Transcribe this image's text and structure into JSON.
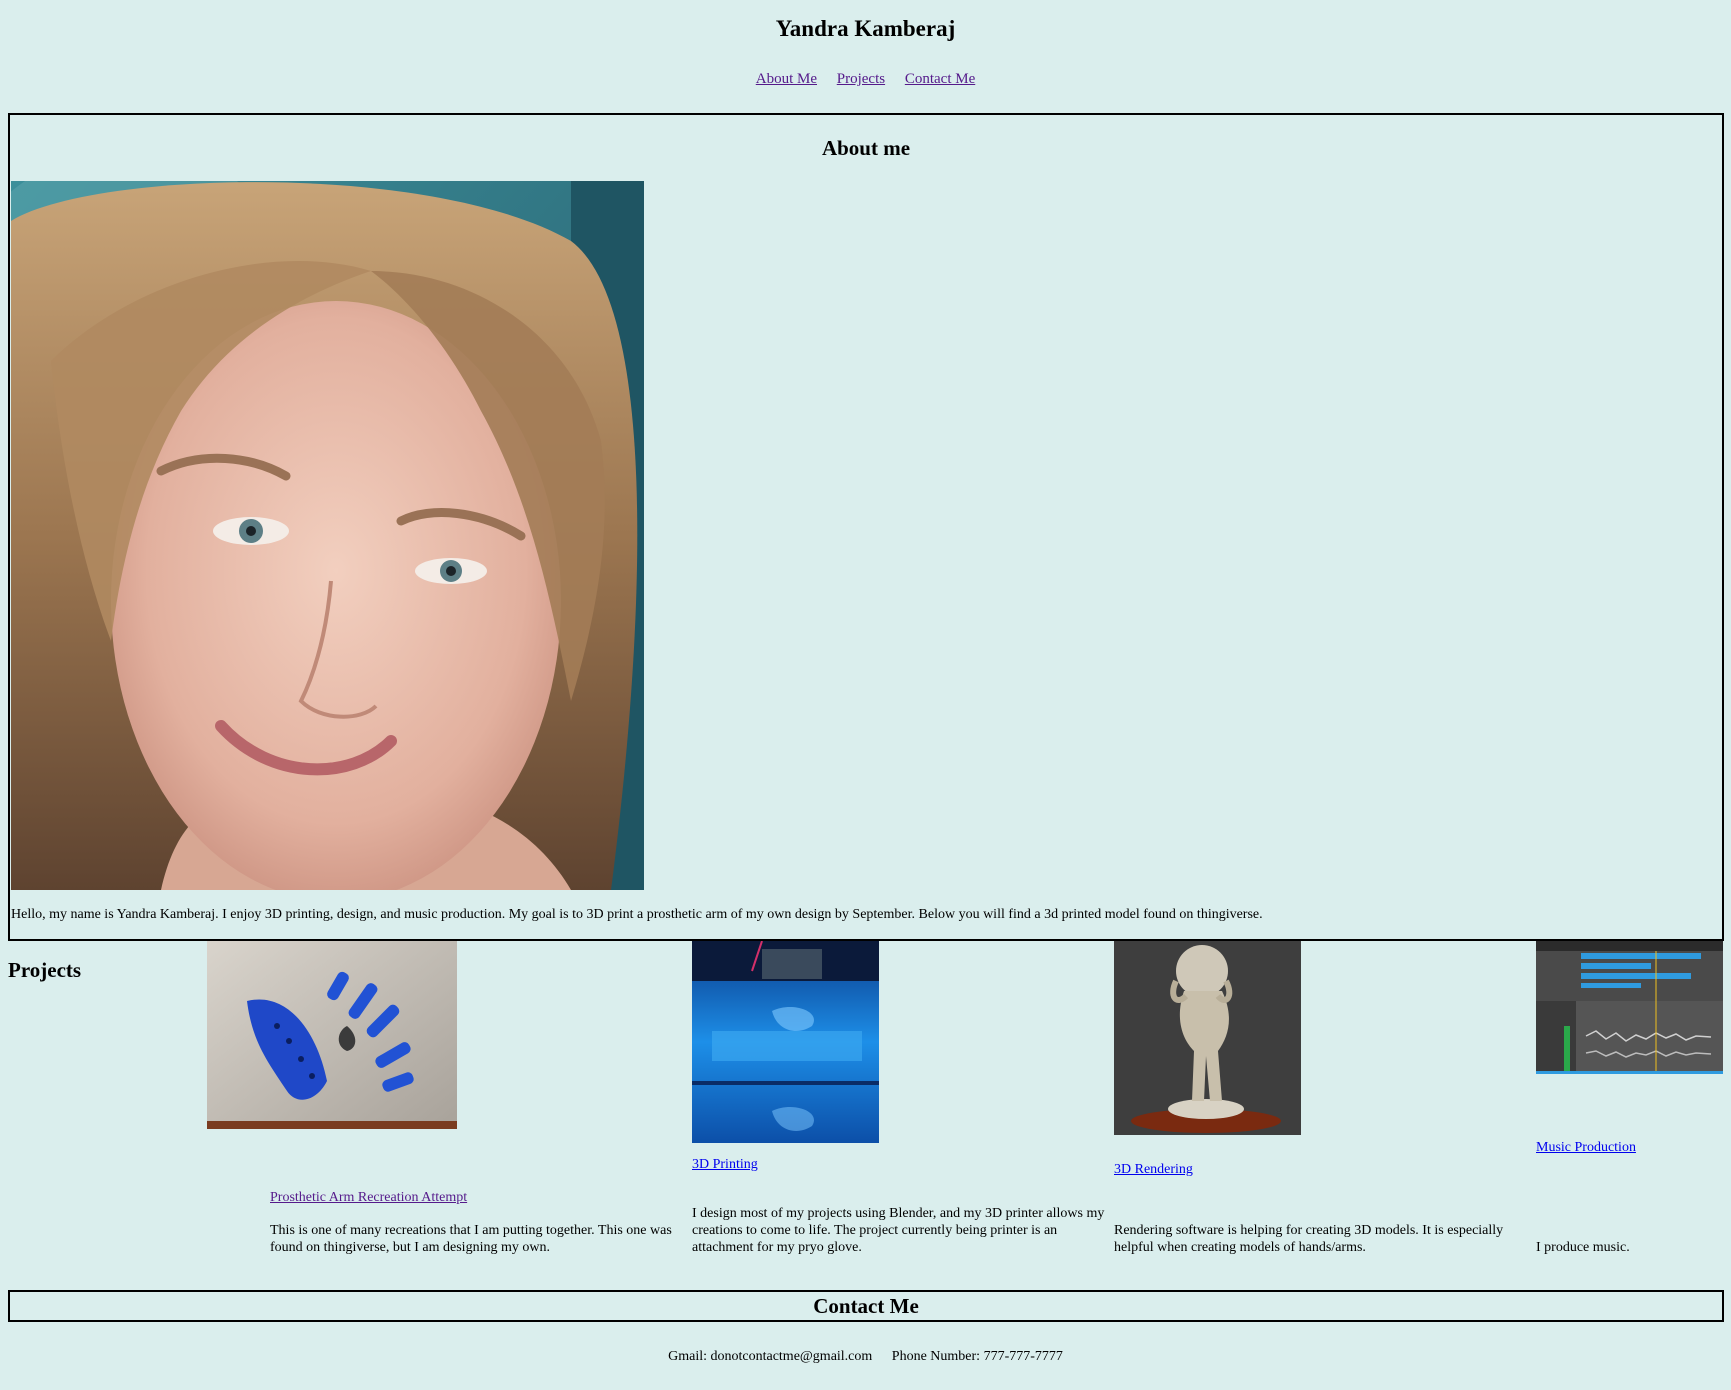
{
  "header": {
    "title": "Yandra Kamberaj",
    "nav": {
      "about": "About Me",
      "projects": "Projects",
      "contact": "Contact Me"
    }
  },
  "about": {
    "title": "About me",
    "text": "Hello, my name is Yandra Kamberaj. I enjoy 3D printing, design, and music production. My goal is to 3D print a prosthetic arm of my own design by September. Below you will find a 3d printed model found on thingiverse."
  },
  "projects": {
    "title": "Projects",
    "items": [
      {
        "link": "Prosthetic Arm Recreation Attempt",
        "desc": "This is one of many recreations that I am putting together. This one was found on thingiverse, but I am designing my own."
      },
      {
        "link": "3D Printing",
        "desc": "I design most of my projects using Blender, and my 3D printer allows my creations to come to life. The project currently being printer is an attachment for my pryo glove."
      },
      {
        "link": "3D Rendering",
        "desc": "Rendering software is helping for creating 3D models. It is especially helpful when creating models of hands/arms."
      },
      {
        "link": "Music Production",
        "desc": "I produce music."
      }
    ]
  },
  "contact": {
    "title": "Contact Me",
    "gmail": "Gmail: donotcontactme@gmail.com",
    "phone": "Phone Number: 777-777-7777"
  },
  "colors": {
    "background": "#daeeed",
    "visited_link": "#551a8b",
    "link": "#0000ee"
  }
}
